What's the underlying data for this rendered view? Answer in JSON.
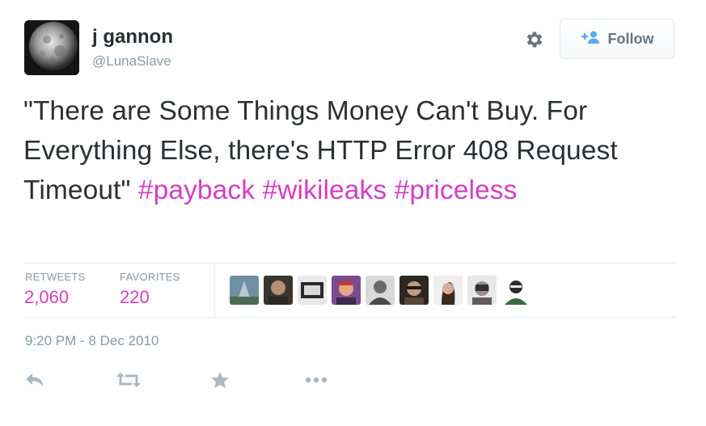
{
  "user": {
    "name": "j gannon",
    "handle": "@LunaSlave"
  },
  "follow_button": {
    "label": "Follow"
  },
  "tweet": {
    "text_plain": "\"There are Some Things Money Can't Buy. For Everything Else, there's HTTP Error 408 Request Timeout\"",
    "hashtags": [
      "#payback",
      "#wikileaks",
      "#priceless"
    ]
  },
  "stats": {
    "retweets_label": "RETWEETS",
    "retweets_count": "2,060",
    "favorites_label": "FAVORITES",
    "favorites_count": "220"
  },
  "timestamp": "9:20 PM - 8 Dec 2010",
  "icons": {
    "settings": "gear-icon",
    "follow": "add-user-icon",
    "reply": "reply-icon",
    "retweet": "retweet-icon",
    "favorite": "star-icon",
    "more": "more-icon"
  },
  "colors": {
    "hashtag": "#d43ec2",
    "muted": "#8899a6",
    "text": "#292f33",
    "follow_icon": "#55acee",
    "action_icon": "#aab8c2"
  }
}
